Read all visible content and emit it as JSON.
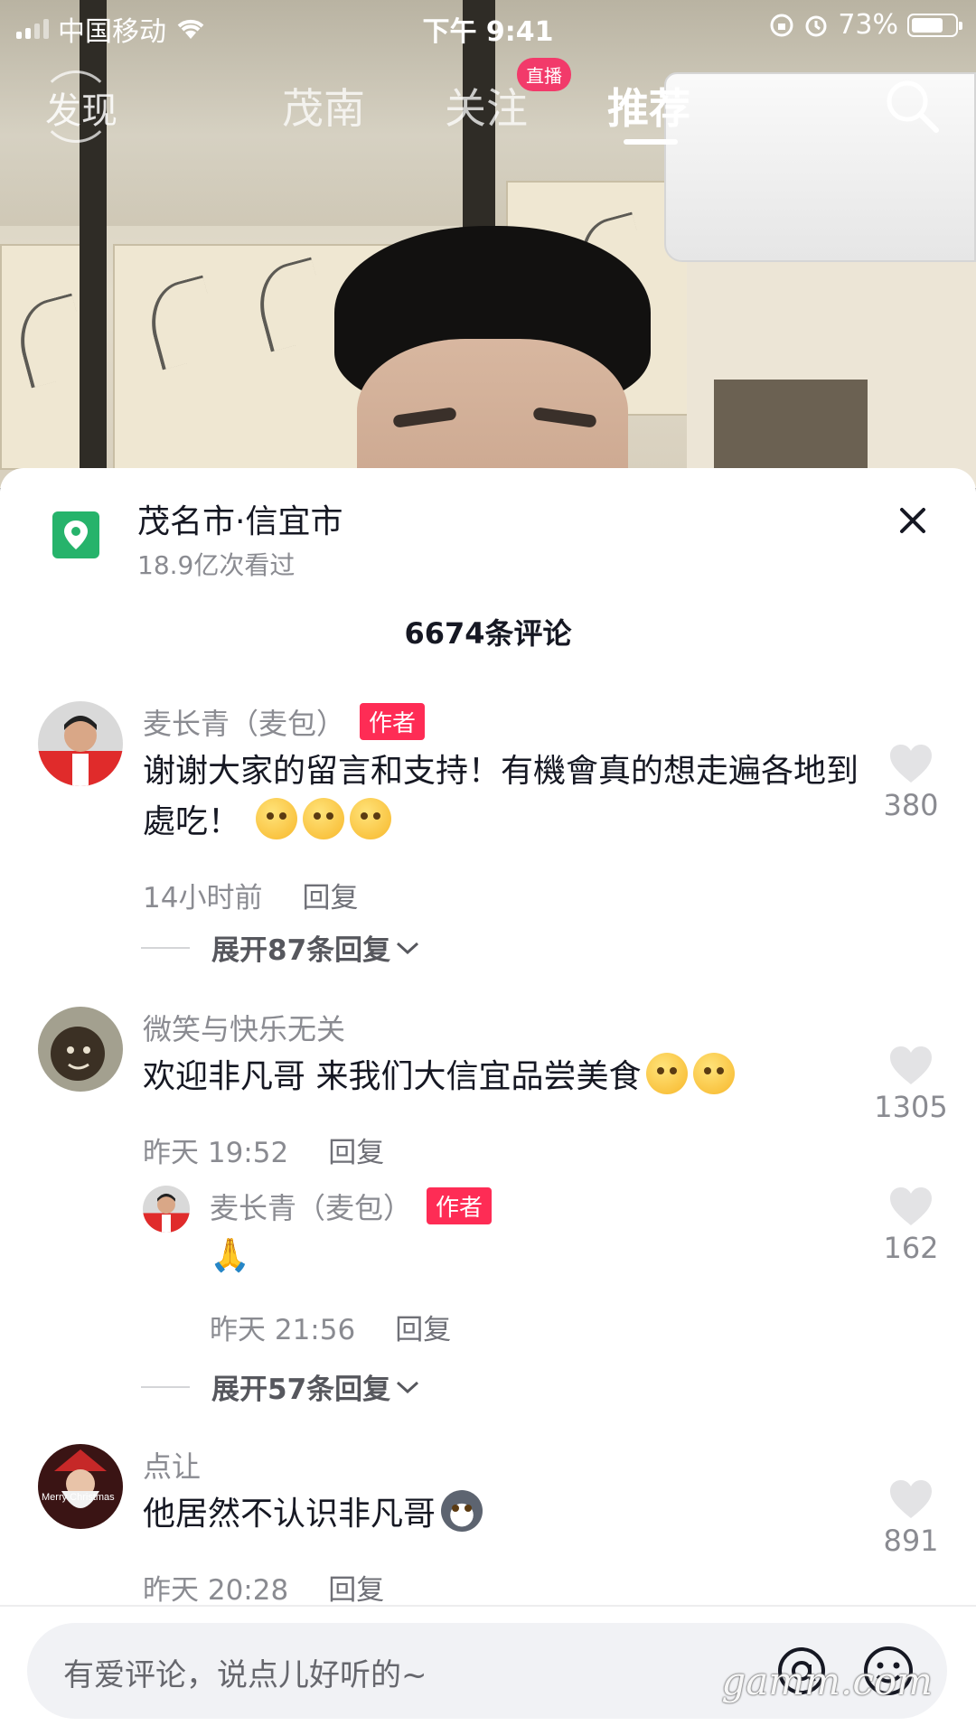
{
  "status_bar": {
    "carrier": "中国移动",
    "time": "下午 9:41",
    "battery": "73%"
  },
  "top_nav": {
    "discover": "发现",
    "tabs": [
      {
        "label": "茂南"
      },
      {
        "label": "关注",
        "badge": "直播"
      },
      {
        "label": "推荐"
      }
    ]
  },
  "location": {
    "title": "茂名市·信宜市",
    "views": "18.9亿次看过"
  },
  "comment_count": "6674条评论",
  "comments": [
    {
      "user": "麦长青（麦包）",
      "tag": "作者",
      "text": "谢谢大家的留言和支持！有機會真的想走遍各地到處吃！",
      "time": "14小时前",
      "reply": "回复",
      "likes": "380",
      "expand": "展开87条回复"
    },
    {
      "user": "微笑与快乐无关",
      "text": "欢迎非凡哥 来我们大信宜品尝美食",
      "time": "昨天 19:52",
      "reply": "回复",
      "likes": "1305",
      "sub_reply": {
        "user": "麦长青（麦包）",
        "tag": "作者",
        "text": "🙏",
        "time": "昨天 21:56",
        "reply": "回复",
        "likes": "162"
      },
      "expand": "展开57条回复"
    },
    {
      "user": "点让",
      "text": "他居然不认识非凡哥",
      "time": "昨天 20:28",
      "reply": "回复",
      "likes": "891",
      "avatar_text": "Merry Christmas"
    }
  ],
  "input": {
    "placeholder": "有爱评论，说点儿好听的~"
  },
  "watermark": "gamm.com",
  "colors": {
    "author_tag": "#fe2c55",
    "live_badge": "#f23a6a",
    "location_icon": "#26b36b"
  }
}
